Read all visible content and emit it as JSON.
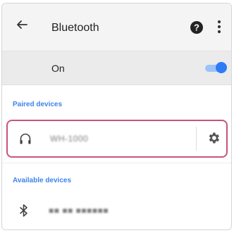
{
  "header": {
    "title": "Bluetooth",
    "back_icon": "arrow-left-icon",
    "help_icon": "help-circle-icon",
    "more_icon": "more-vert-icon"
  },
  "bluetooth_toggle": {
    "label": "On",
    "state": "on",
    "accent_color": "#2d7cf6"
  },
  "paired_section": {
    "label": "Paired devices",
    "devices": [
      {
        "name": "WH-1000",
        "icon": "headphones-icon",
        "settings_icon": "gear-icon"
      }
    ]
  },
  "available_section": {
    "label": "Available devices",
    "devices": [
      {
        "name": "■■ ■■ ■■■■■■",
        "icon": "bluetooth-icon"
      }
    ]
  },
  "highlight_color": "#c9537a"
}
